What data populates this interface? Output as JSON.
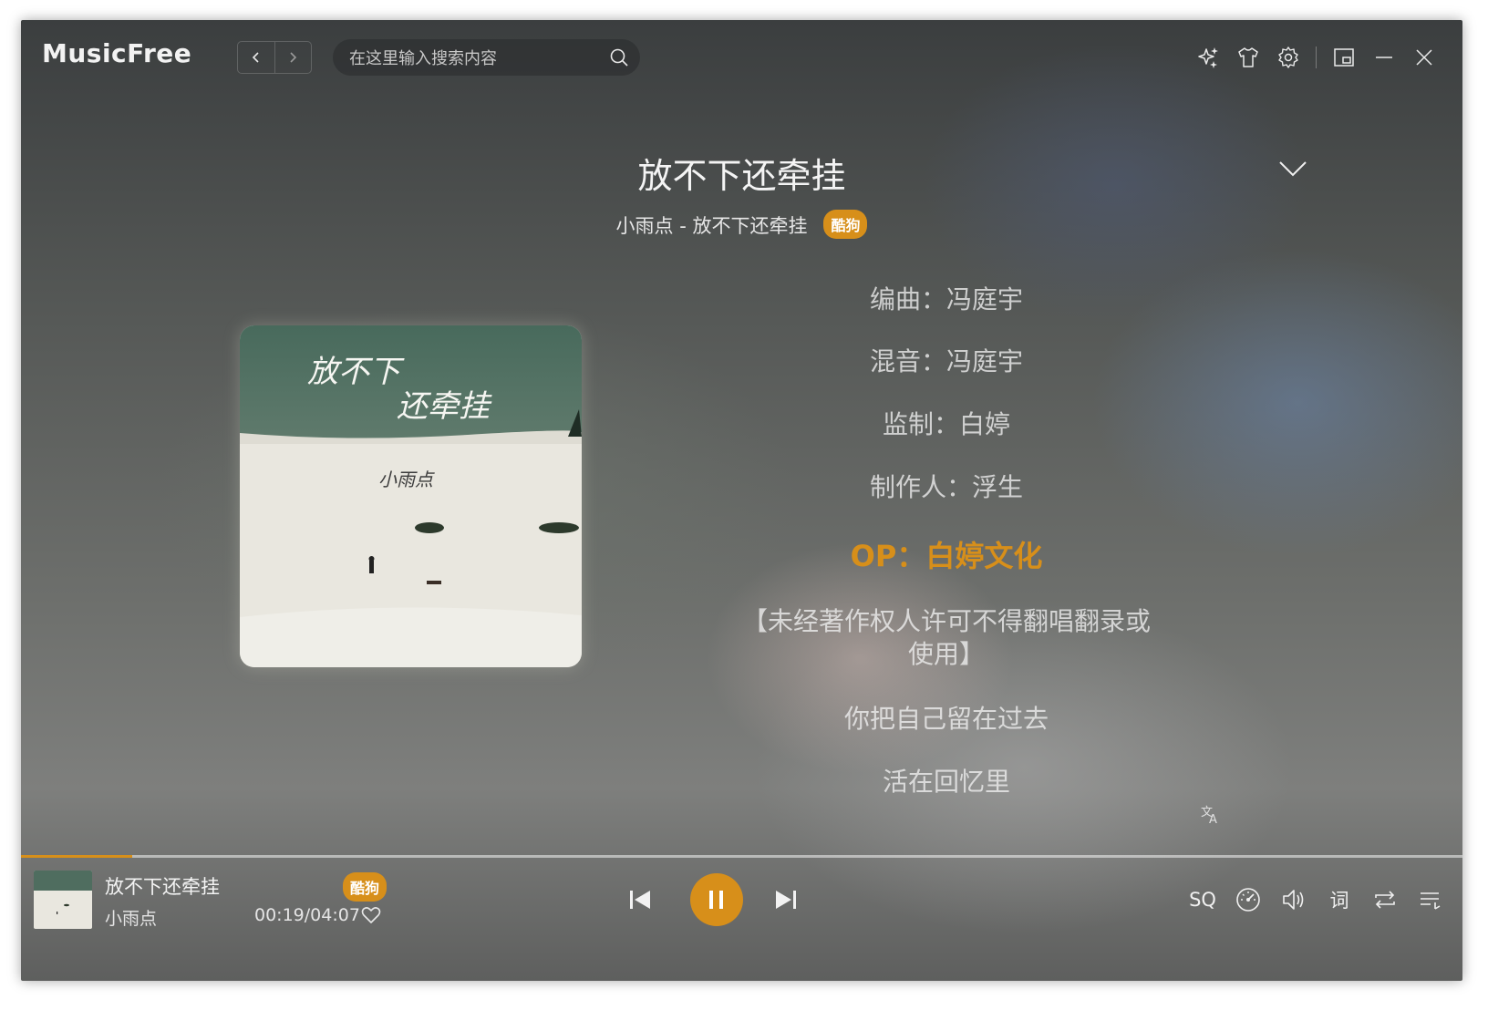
{
  "app": {
    "name": "MusicFree"
  },
  "search": {
    "placeholder": "在这里输入搜索内容"
  },
  "toolbar_icons": [
    "sparkle-icon",
    "shirt-icon",
    "gear-icon",
    "mini-mode-icon",
    "minimize-icon",
    "close-icon"
  ],
  "song": {
    "title": "放不下还牵挂",
    "subtitle": "小雨点 - 放不下还牵挂",
    "source": "酷狗",
    "artist": "小雨点"
  },
  "lyrics": [
    {
      "text": "编曲：冯庭宇",
      "active": false
    },
    {
      "text": "混音：冯庭宇",
      "active": false
    },
    {
      "text": "监制：白婷",
      "active": false
    },
    {
      "text": "制作人：浮生",
      "active": false
    },
    {
      "text": "OP：白婷文化",
      "active": true
    },
    {
      "text": "【未经著作权人许可不得翻唱翻录或使用】",
      "active": false
    },
    {
      "text": "你把自己留在过去",
      "active": false
    },
    {
      "text": "活在回忆里",
      "active": false
    }
  ],
  "cover_art": {
    "title_line1": "放不下",
    "title_line2": "还牵挂",
    "artist": "小雨点"
  },
  "player": {
    "time": "00:19/04:07",
    "progress": 0.077,
    "quality": "SQ",
    "lyric_toggle": "词"
  },
  "colors": {
    "accent": "#d78f1a"
  }
}
